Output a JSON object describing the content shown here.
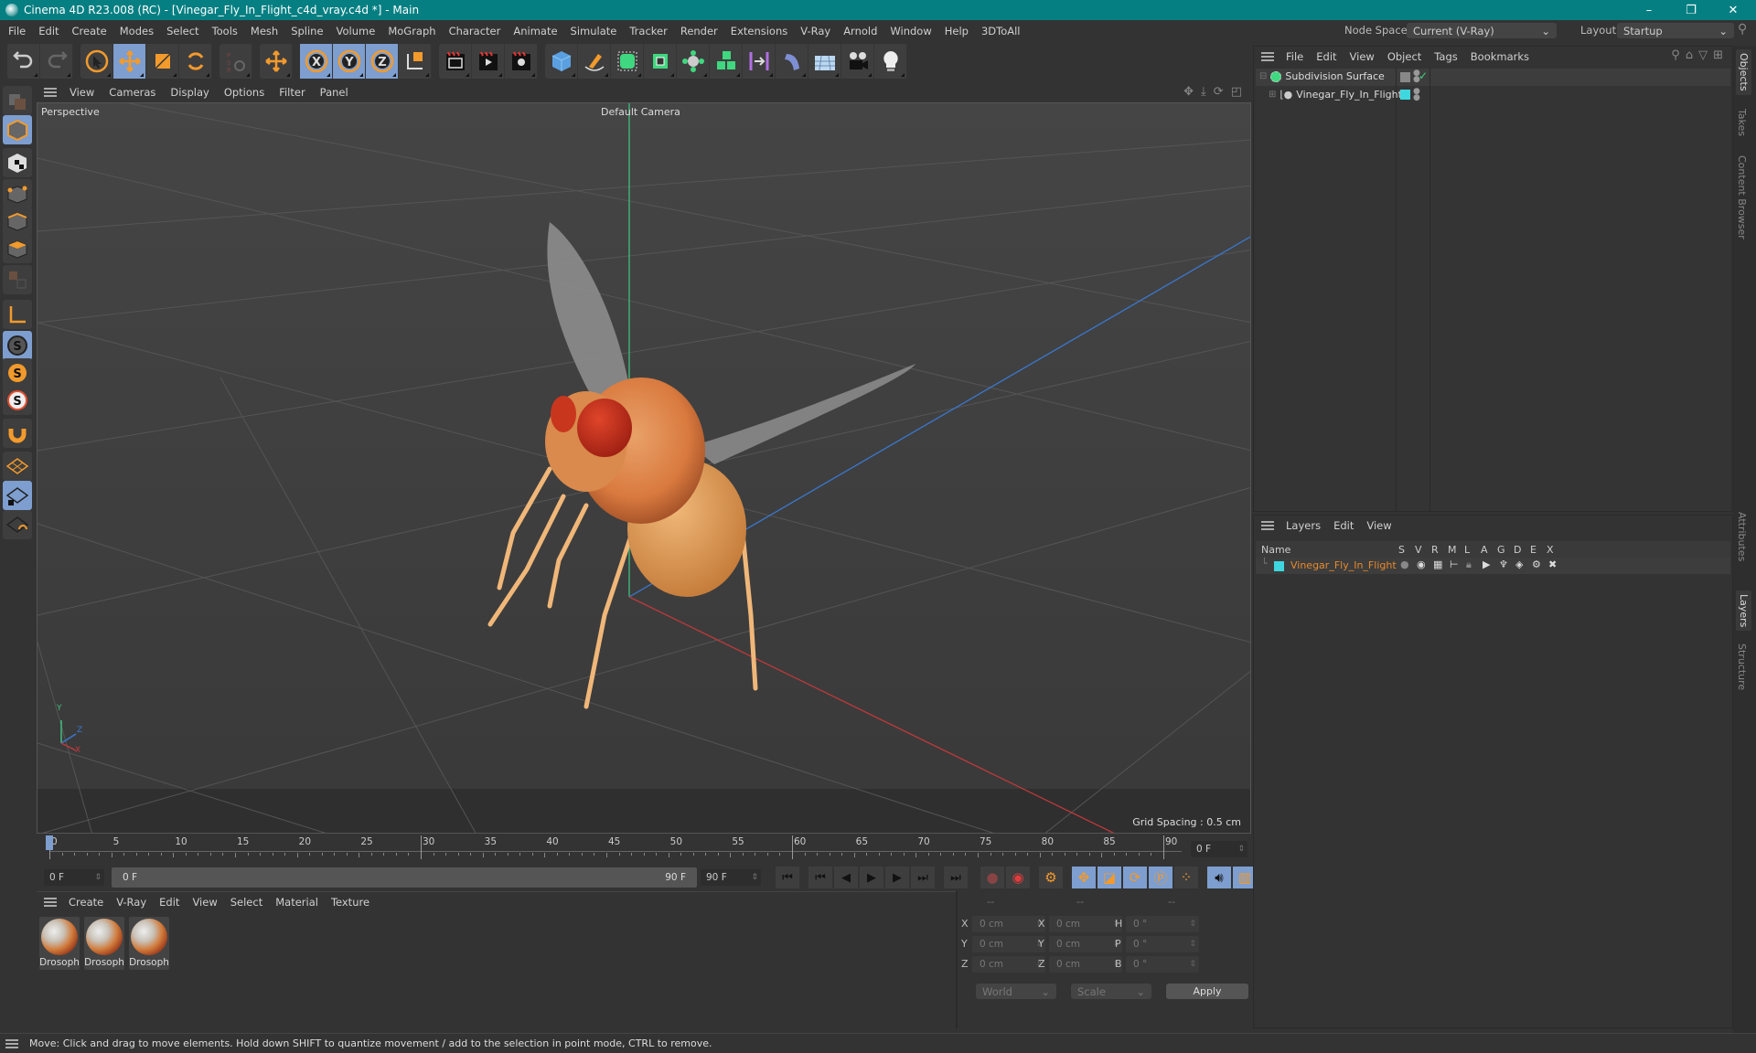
{
  "window": {
    "title": "Cinema 4D R23.008 (RC) - [Vinegar_Fly_In_Flight_c4d_vray.c4d *] - Main",
    "controls": {
      "minimize": "–",
      "restore": "❐",
      "close": "✕"
    }
  },
  "menubar": {
    "items": [
      "File",
      "Edit",
      "Create",
      "Modes",
      "Select",
      "Tools",
      "Mesh",
      "Spline",
      "Volume",
      "MoGraph",
      "Character",
      "Animate",
      "Simulate",
      "Tracker",
      "Render",
      "Extensions",
      "V-Ray",
      "Arnold",
      "Window",
      "Help",
      "3DToAll"
    ],
    "node_space_label": "Node Space:",
    "node_space_value": "Current (V-Ray)",
    "layout_label": "Layout:",
    "layout_value": "Startup"
  },
  "toolbar": {
    "groups": [
      [
        "undo-icon",
        "redo-icon"
      ],
      [
        "live-selection-icon",
        "move-icon",
        "scale-icon",
        "rotate-icon"
      ],
      [
        "psr-lock-icon"
      ],
      [
        "move-alt-icon"
      ],
      [
        "x-axis-lock-icon",
        "y-axis-lock-icon",
        "z-axis-lock-icon",
        "coordinate-system-icon"
      ],
      [
        "render-view-icon",
        "render-picture-viewer-icon",
        "render-settings-icon"
      ],
      [
        "cube-icon",
        "pen-icon",
        "subdivision-surface-icon",
        "extrude-icon",
        "mograph-cloner-icon",
        "array-icon",
        "symmetry-icon",
        "deformer-icon",
        "floor-icon",
        "camera-icon",
        "light-icon"
      ]
    ],
    "active": [
      "move-icon",
      "x-axis-lock-icon",
      "y-axis-lock-icon",
      "z-axis-lock-icon"
    ]
  },
  "left_tools": [
    "make-editable-icon",
    "model-mode-icon",
    "texture-mode-icon",
    "point-mode-icon",
    "edge-mode-icon",
    "polygon-mode-icon",
    "uv-mode-icon",
    "axis-mode-icon",
    "snap-icon",
    "snap-settings-icon",
    "soft-selection-icon",
    "magnet-icon",
    "workplane-icon",
    "locked-workplane-icon",
    "planar-workplane-icon"
  ],
  "viewport": {
    "menu": [
      "View",
      "Cameras",
      "Display",
      "Options",
      "Filter",
      "Panel"
    ],
    "view_name": "Perspective",
    "camera_name": "Default Camera",
    "grid_spacing": "Grid Spacing : 0.5 cm",
    "axis_labels": {
      "x": "X",
      "y": "Y",
      "z": "Z"
    },
    "nav_icons": [
      "pan-icon",
      "dolly-icon",
      "orbit-icon",
      "maximize-view-icon"
    ],
    "colors": {
      "x_axis": "#c0393b",
      "y_axis": "#3fbf7f",
      "z_axis": "#3a78d0"
    }
  },
  "timeline": {
    "ticks": [
      "0",
      "5",
      "10",
      "15",
      "20",
      "25",
      "30",
      "35",
      "40",
      "45",
      "50",
      "55",
      "60",
      "65",
      "70",
      "75",
      "80",
      "85",
      "90"
    ],
    "current_frame": "0 F",
    "start_frame": "0 F",
    "range_start": "0 F",
    "range_end": "90 F",
    "end_frame": "90 F",
    "playhead_frame": 0,
    "max_frame": 90
  },
  "playback": {
    "buttons": [
      "go-to-start-icon",
      "previous-key-icon",
      "previous-frame-icon",
      "play-icon",
      "next-frame-icon",
      "next-key-icon",
      "go-to-end-icon"
    ],
    "record_buttons": [
      "record-keys-icon",
      "autokey-icon",
      "keyframe-selection-icon",
      "position-key-icon",
      "scale-key-icon",
      "rotation-key-icon",
      "parameter-key-icon",
      "pla-key-icon",
      "sound-icon",
      "timeline-icon"
    ]
  },
  "materials": {
    "menu": [
      "Create",
      "V-Ray",
      "Edit",
      "View",
      "Select",
      "Material",
      "Texture"
    ],
    "items": [
      {
        "name": "Drosoph"
      },
      {
        "name": "Drosoph"
      },
      {
        "name": "Drosoph"
      }
    ]
  },
  "coordinates": {
    "headers": [
      "--",
      "--",
      "--"
    ],
    "rows": [
      {
        "l1": "X",
        "v1": "0 cm",
        "l2": "X",
        "v2": "0 cm",
        "l3": "H",
        "v3": "0 °"
      },
      {
        "l1": "Y",
        "v1": "0 cm",
        "l2": "Y",
        "v2": "0 cm",
        "l3": "P",
        "v3": "0 °"
      },
      {
        "l1": "Z",
        "v1": "0 cm",
        "l2": "Z",
        "v2": "0 cm",
        "l3": "B",
        "v3": "0 °"
      }
    ],
    "mode": "World",
    "transform": "Scale",
    "apply_label": "Apply"
  },
  "objects_panel": {
    "menu": [
      "File",
      "Edit",
      "View",
      "Object",
      "Tags",
      "Bookmarks"
    ],
    "tree": [
      {
        "name": "Subdivision Surface",
        "level": 0,
        "expanded": true
      },
      {
        "name": "Vinegar_Fly_In_Flight",
        "level": 1,
        "expanded": false,
        "layer_color": "#3fd7df"
      }
    ]
  },
  "layers_panel": {
    "menu": [
      "Layers",
      "Edit",
      "View"
    ],
    "columns": [
      "Name",
      "S",
      "V",
      "R",
      "M",
      "L",
      "A",
      "G",
      "D",
      "E",
      "X"
    ],
    "rows": [
      {
        "name": "Vinegar_Fly_In_Flight",
        "color": "#3fd7df",
        "name_color": "#e8892b"
      }
    ]
  },
  "right_tabs": {
    "top": [
      {
        "label": "Objects",
        "active": true
      },
      {
        "label": "Takes",
        "active": false
      },
      {
        "label": "Content Browser",
        "active": false
      }
    ],
    "bottom": [
      {
        "label": "Attributes",
        "active": false
      },
      {
        "label": "Layers",
        "active": true
      },
      {
        "label": "Structure",
        "active": false
      }
    ]
  },
  "status": {
    "message": "Move: Click and drag to move elements. Hold down SHIFT to quantize movement / add to the selection in point mode, CTRL to remove."
  }
}
